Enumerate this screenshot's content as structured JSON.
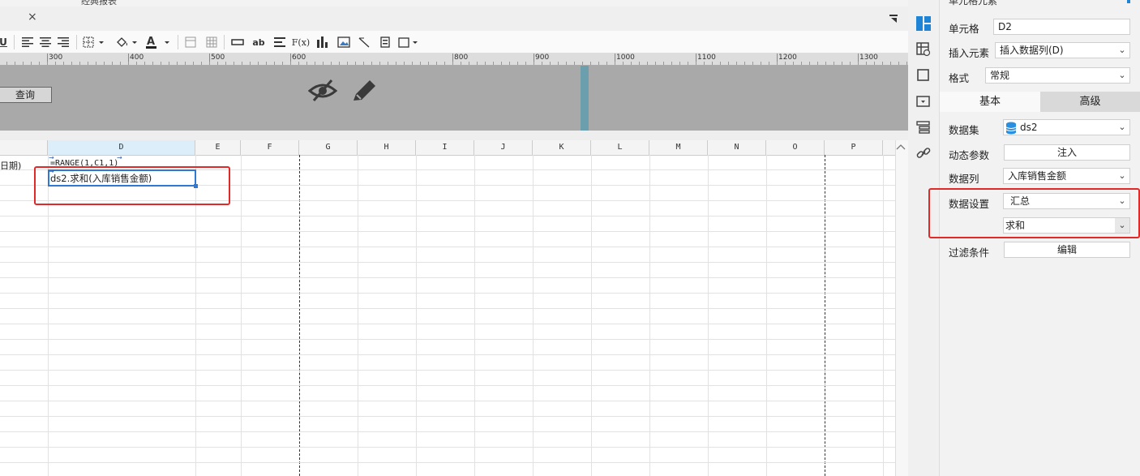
{
  "topbar": {
    "label_fragment": "经典报表"
  },
  "tabbar": {
    "close_glyph": "×",
    "collapse_glyph": "▾"
  },
  "ruler": {
    "labels": [
      "300",
      "400",
      "500",
      "600",
      "800",
      "900",
      "1000",
      "1100",
      "1200",
      "1300"
    ]
  },
  "param_panel": {
    "query_button": "查询"
  },
  "grid": {
    "columns": [
      "D",
      "E",
      "F",
      "G",
      "H",
      "I",
      "J",
      "K",
      "L",
      "M",
      "N",
      "O",
      "P"
    ],
    "selected_column": "D",
    "cells": {
      "C1": "日期)",
      "D1": "=RANGE(1,C1,1)",
      "D2": "ds2.求和(入库销售金额)"
    }
  },
  "right_panel": {
    "title": "单元格元素",
    "cell_label": "单元格",
    "cell_value": "D2",
    "insert_label": "插入元素",
    "insert_value": "插入数据列(D)",
    "format_label": "格式",
    "format_value": "常规",
    "tabs": {
      "basic": "基本",
      "advanced": "高级"
    },
    "dataset_label": "数据集",
    "dataset_value": "ds2",
    "dynamic_param_label": "动态参数",
    "dynamic_param_button": "注入",
    "column_label": "数据列",
    "column_value": "入库销售金额",
    "data_setting_label": "数据设置",
    "data_setting_value": "汇总",
    "aggregate_value": "求和",
    "filter_label": "过滤条件",
    "filter_button": "编辑"
  },
  "colors": {
    "accent": "#1f83d6",
    "highlight": "#e02a2a",
    "selection": "#2f78d3"
  }
}
